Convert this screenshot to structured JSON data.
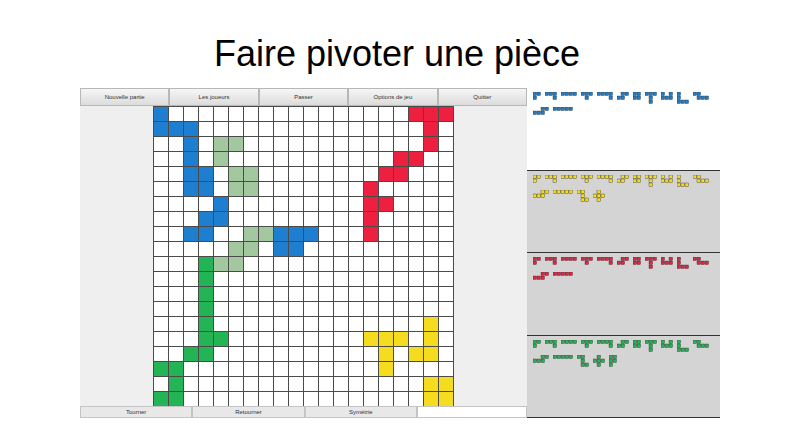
{
  "slide": {
    "title": "Faire pivoter une pièce"
  },
  "menu_bar": {
    "buttons": [
      "Nouvelle partie",
      "Les joueurs",
      "Passer",
      "Options de jeu",
      "Quitter"
    ]
  },
  "bottom_bar": {
    "buttons": [
      "Tourner",
      "Retourner",
      "Symétrie"
    ]
  },
  "board": {
    "size": 20,
    "placed": [
      {
        "player": "blue",
        "color": "#1e7fd0",
        "ghost": false,
        "cells": [
          [
            0,
            0
          ],
          [
            0,
            1
          ],
          [
            1,
            1
          ],
          [
            2,
            1
          ],
          [
            2,
            2
          ],
          [
            2,
            3
          ],
          [
            2,
            4
          ],
          [
            3,
            4
          ],
          [
            2,
            5
          ],
          [
            3,
            5
          ],
          [
            4,
            6
          ],
          [
            4,
            7
          ],
          [
            3,
            7
          ],
          [
            2,
            8
          ],
          [
            3,
            8
          ],
          [
            8,
            8
          ],
          [
            9,
            8
          ],
          [
            10,
            8
          ],
          [
            8,
            9
          ],
          [
            9,
            9
          ]
        ]
      },
      {
        "player": "ghost",
        "color": "#a3c79e",
        "ghost": true,
        "cells": [
          [
            4,
            2
          ],
          [
            5,
            2
          ],
          [
            4,
            3
          ],
          [
            5,
            4
          ],
          [
            6,
            4
          ],
          [
            5,
            5
          ],
          [
            6,
            5
          ],
          [
            7,
            8
          ],
          [
            6,
            8
          ],
          [
            5,
            9
          ],
          [
            6,
            9
          ],
          [
            4,
            10
          ],
          [
            5,
            10
          ]
        ]
      },
      {
        "player": "red",
        "color": "#ee2040",
        "ghost": false,
        "cells": [
          [
            17,
            0
          ],
          [
            18,
            0
          ],
          [
            19,
            0
          ],
          [
            18,
            1
          ],
          [
            18,
            2
          ],
          [
            16,
            3
          ],
          [
            17,
            3
          ],
          [
            15,
            4
          ],
          [
            16,
            4
          ],
          [
            14,
            5
          ],
          [
            14,
            6
          ],
          [
            15,
            6
          ],
          [
            14,
            7
          ],
          [
            14,
            8
          ]
        ]
      },
      {
        "player": "green",
        "color": "#22b455",
        "ghost": false,
        "cells": [
          [
            3,
            10
          ],
          [
            3,
            11
          ],
          [
            3,
            12
          ],
          [
            3,
            13
          ],
          [
            3,
            14
          ],
          [
            3,
            15
          ],
          [
            4,
            15
          ],
          [
            2,
            16
          ],
          [
            3,
            16
          ],
          [
            0,
            17
          ],
          [
            1,
            17
          ],
          [
            1,
            18
          ],
          [
            0,
            19
          ],
          [
            1,
            19
          ]
        ]
      },
      {
        "player": "yellow",
        "color": "#f5dc1f",
        "ghost": false,
        "cells": [
          [
            14,
            15
          ],
          [
            15,
            15
          ],
          [
            16,
            15
          ],
          [
            15,
            16
          ],
          [
            15,
            17
          ],
          [
            18,
            14
          ],
          [
            18,
            15
          ],
          [
            17,
            16
          ],
          [
            18,
            16
          ],
          [
            18,
            18
          ],
          [
            19,
            18
          ],
          [
            18,
            19
          ],
          [
            19,
            19
          ]
        ]
      }
    ]
  },
  "players": [
    {
      "name": "blue",
      "color": "#1e7fd0",
      "selected": true,
      "pieces": 13
    },
    {
      "name": "yellow",
      "color": "#f5dc1f",
      "selected": false,
      "pieces": 15
    },
    {
      "name": "red",
      "color": "#ee2040",
      "selected": false,
      "pieces": 13
    },
    {
      "name": "green",
      "color": "#22b455",
      "selected": false,
      "pieces": 16
    }
  ]
}
